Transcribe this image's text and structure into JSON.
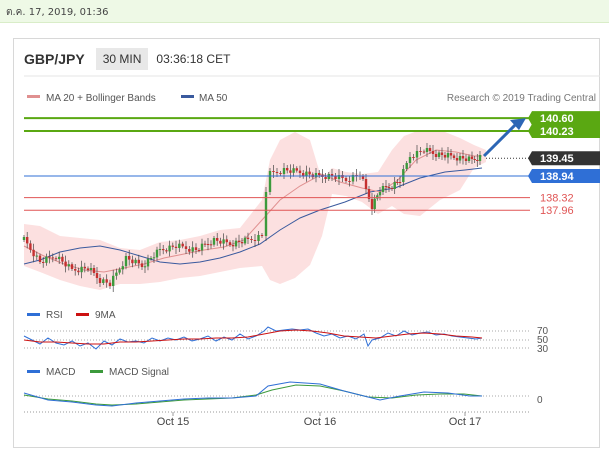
{
  "date_bar": "ต.ค. 17, 2019, 01:36",
  "header": {
    "symbol": "GBP/JPY",
    "timeframe": "30 MIN",
    "time": "03:36:18 CET"
  },
  "legend": {
    "ma20": "MA 20 + Bollinger Bands",
    "ma50": "MA 50",
    "credit": "Research © 2019 Trading Central",
    "rsi": "RSI",
    "rsi_ma": "9MA",
    "macd": "MACD",
    "macd_signal": "MACD Signal"
  },
  "colors": {
    "green": "#5aa812",
    "blue": "#2f6fd6",
    "red": "#e05555",
    "bull": "#3c9a3c",
    "bear": "#c53030",
    "band": "#fbd5d5",
    "ma50": "#3a5a9e",
    "ma20": "#e09090",
    "last": "#333333"
  },
  "chart_data": {
    "type": "candlestick",
    "symbol": "GBP/JPY",
    "timeframe": "30 MIN",
    "ylim": [
      137.0,
      141.0
    ],
    "x_ticks": [
      "Oct 15",
      "Oct 16",
      "Oct 17"
    ],
    "levels": [
      {
        "value": 140.6,
        "label": "140.60",
        "kind": "resistance"
      },
      {
        "value": 140.23,
        "label": "140.23",
        "kind": "resistance"
      },
      {
        "value": 139.45,
        "label": "139.45",
        "kind": "last"
      },
      {
        "value": 138.94,
        "label": "138.94",
        "kind": "pivot"
      },
      {
        "value": 138.32,
        "label": "138.32",
        "kind": "support"
      },
      {
        "value": 137.96,
        "label": "137.96",
        "kind": "support"
      }
    ],
    "target": 140.6,
    "rsi": {
      "levels": [
        "70",
        "50",
        "30"
      ]
    },
    "macd": {
      "zero_label": "0"
    }
  }
}
